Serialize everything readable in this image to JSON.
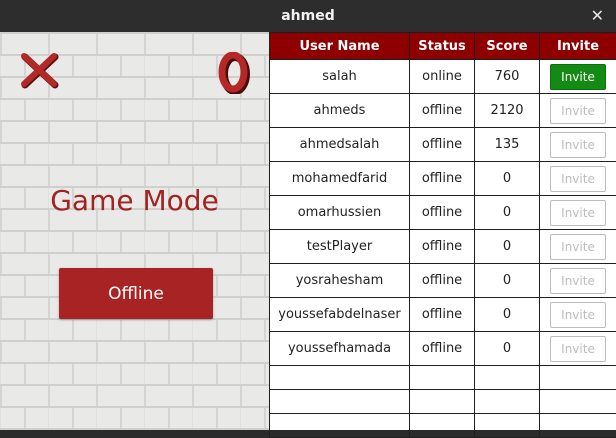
{
  "window": {
    "title": "ahmed"
  },
  "game": {
    "mode_title": "Game Mode",
    "offline_label": "Offline"
  },
  "table": {
    "headers": [
      "User Name",
      "Status",
      "Score",
      "Invite"
    ],
    "rows": [
      {
        "user": "salah",
        "status": "online",
        "score": "760",
        "invite": "Invite",
        "enabled": true
      },
      {
        "user": "ahmeds",
        "status": "offline",
        "score": "2120",
        "invite": "Invite",
        "enabled": false
      },
      {
        "user": "ahmedsalah",
        "status": "offline",
        "score": "135",
        "invite": "Invite",
        "enabled": false
      },
      {
        "user": "mohamedfarid",
        "status": "offline",
        "score": "0",
        "invite": "Invite",
        "enabled": false
      },
      {
        "user": "omarhussien",
        "status": "offline",
        "score": "0",
        "invite": "Invite",
        "enabled": false
      },
      {
        "user": "testPlayer",
        "status": "offline",
        "score": "0",
        "invite": "Invite",
        "enabled": false
      },
      {
        "user": "yosrahesham",
        "status": "offline",
        "score": "0",
        "invite": "Invite",
        "enabled": false
      },
      {
        "user": "youssefabdelnaser",
        "status": "offline",
        "score": "0",
        "invite": "Invite",
        "enabled": false
      },
      {
        "user": "youssefhamada",
        "status": "offline",
        "score": "0",
        "invite": "Invite",
        "enabled": false
      }
    ]
  },
  "colors": {
    "accent": "#a82424",
    "header": "#8e0000",
    "invite_active": "#138a13"
  },
  "icons": {
    "close": "close-icon",
    "x_logo": "x-logo-icon",
    "o_logo": "o-logo-icon"
  }
}
